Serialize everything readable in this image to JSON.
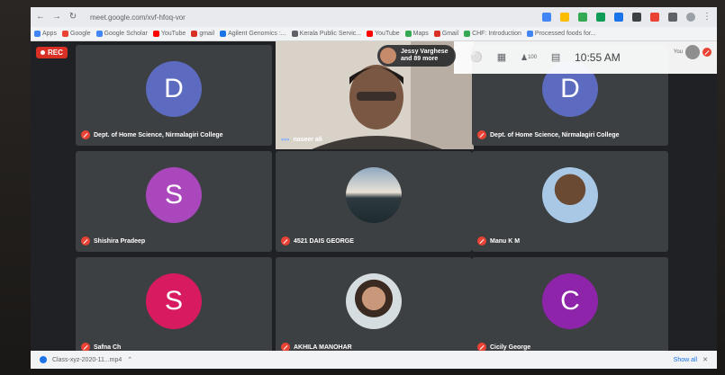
{
  "browser": {
    "url": "meet.google.com/xvf-hfoq-vor",
    "bookmarks": [
      "Apps",
      "Google",
      "Google Scholar",
      "YouTube",
      "gmail",
      "Agilent Genomics :...",
      "Kerala Public Servic...",
      "YouTube",
      "Maps",
      "Gmail",
      "CHF: Introduction",
      "Processed foods for..."
    ]
  },
  "meet": {
    "rec_label": "REC",
    "speaker": {
      "line1": "Jessy Varghese",
      "line2": "and 89 more"
    },
    "clock": "10:55 AM",
    "participant_count": "100",
    "you_label": "You",
    "presenter_name": "naseer ali",
    "tiles": [
      {
        "name": "Dept. of Home Science, Nirmalagiri College",
        "letter": "D",
        "color": "#5c6bc0"
      },
      {
        "name": "Dept. of Home Science, Nirmalagiri College",
        "letter": "D",
        "color": "#5c6bc0"
      },
      {
        "name": "Shishira Pradeep",
        "letter": "S",
        "color": "#ab47bc"
      },
      {
        "name": "4521 DAIS GEORGE",
        "letter": "",
        "color": "#4a5560"
      },
      {
        "name": "Manu K M",
        "letter": "",
        "color": "#6a8fb8"
      },
      {
        "name": "Safna Ch",
        "letter": "S",
        "color": "#d81b60"
      },
      {
        "name": "AKHILA MANOHAR",
        "letter": "",
        "color": "#7a8a86"
      },
      {
        "name": "Cicily George",
        "letter": "C",
        "color": "#8e24aa"
      }
    ]
  },
  "bottom": {
    "download": "Class-xyz-2020-11...mp4",
    "show_all": "Show all"
  }
}
